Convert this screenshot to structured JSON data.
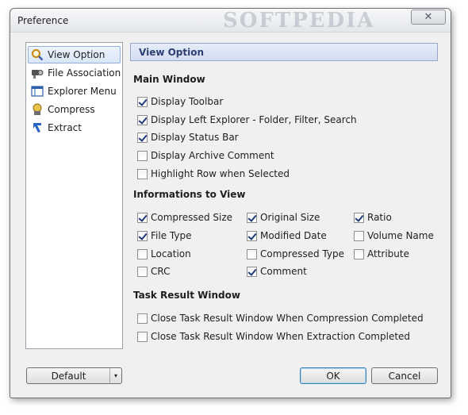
{
  "window": {
    "title": "Preference",
    "watermark": "SOFTPEDIA",
    "close_glyph": "✕"
  },
  "sidebar": {
    "items": [
      {
        "label": "View Option",
        "icon": "magnifier-icon",
        "active": true
      },
      {
        "label": "File Association",
        "icon": "association-icon",
        "active": false
      },
      {
        "label": "Explorer Menu",
        "icon": "window-icon",
        "active": false
      },
      {
        "label": "Compress",
        "icon": "compress-icon",
        "active": false
      },
      {
        "label": "Extract",
        "icon": "extract-arrow-icon",
        "active": false
      }
    ]
  },
  "panel": {
    "header": "View Option",
    "main_window": {
      "title": "Main Window",
      "options": [
        {
          "label": "Display Toolbar",
          "checked": true
        },
        {
          "label": "Display Left Explorer - Folder, Filter, Search",
          "checked": true
        },
        {
          "label": "Display Status Bar",
          "checked": true
        },
        {
          "label": "Display Archive Comment",
          "checked": false
        },
        {
          "label": "Highlight Row when Selected",
          "checked": false
        }
      ]
    },
    "informations": {
      "title": "Informations to View",
      "options": [
        {
          "label": "Compressed Size",
          "checked": true
        },
        {
          "label": "Original Size",
          "checked": true
        },
        {
          "label": "Ratio",
          "checked": true
        },
        {
          "label": "File Type",
          "checked": true
        },
        {
          "label": "Modified Date",
          "checked": true
        },
        {
          "label": "Volume Name",
          "checked": false
        },
        {
          "label": "Location",
          "checked": false
        },
        {
          "label": "Compressed Type",
          "checked": false
        },
        {
          "label": "Attribute",
          "checked": false
        },
        {
          "label": "CRC",
          "checked": false
        },
        {
          "label": "Comment",
          "checked": true
        }
      ]
    },
    "task_result": {
      "title": "Task Result Window",
      "options": [
        {
          "label": "Close Task Result Window When Compression Completed",
          "checked": false
        },
        {
          "label": "Close Task Result Window When Extraction Completed",
          "checked": false
        }
      ]
    }
  },
  "footer": {
    "default_label": "Default",
    "dropdown_glyph": "▾",
    "ok_label": "OK",
    "cancel_label": "Cancel"
  },
  "colors": {
    "header_bg": "#d3ddf1",
    "header_text": "#2b3f73",
    "selection_border": "#93afd8"
  }
}
